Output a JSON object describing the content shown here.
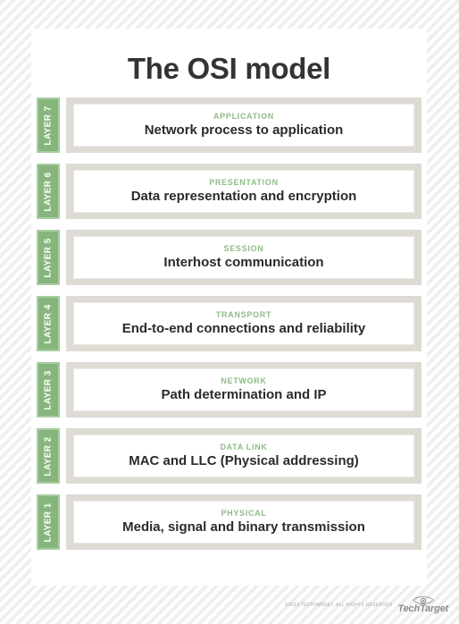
{
  "title": "The OSI model",
  "layers": [
    {
      "tab": "LAYER 7",
      "name": "APPLICATION",
      "description": "Network process to application"
    },
    {
      "tab": "LAYER 6",
      "name": "PRESENTATION",
      "description": "Data representation and encryption"
    },
    {
      "tab": "LAYER 5",
      "name": "SESSION",
      "description": "Interhost communication"
    },
    {
      "tab": "LAYER 4",
      "name": "TRANSPORT",
      "description": "End-to-end connections and reliability"
    },
    {
      "tab": "LAYER 3",
      "name": "NETWORK",
      "description": "Path determination and IP"
    },
    {
      "tab": "LAYER 2",
      "name": "DATA LINK",
      "description": "MAC and LLC (Physical addressing)"
    },
    {
      "tab": "LAYER 1",
      "name": "PHYSICAL",
      "description": "Media, signal and binary transmission"
    }
  ],
  "footer": {
    "copyright": "©2019 TECHTARGET, ALL RIGHTS RESERVED",
    "logo_text": "TechTarget",
    "logo_icon": "eye-icon"
  },
  "colors": {
    "tab_fill": "#87b67d",
    "tab_border": "#a9cda1",
    "layer_name": "#8fbc87",
    "frame": "#dedbd4",
    "title": "#333333",
    "description": "#2b2b2b"
  }
}
